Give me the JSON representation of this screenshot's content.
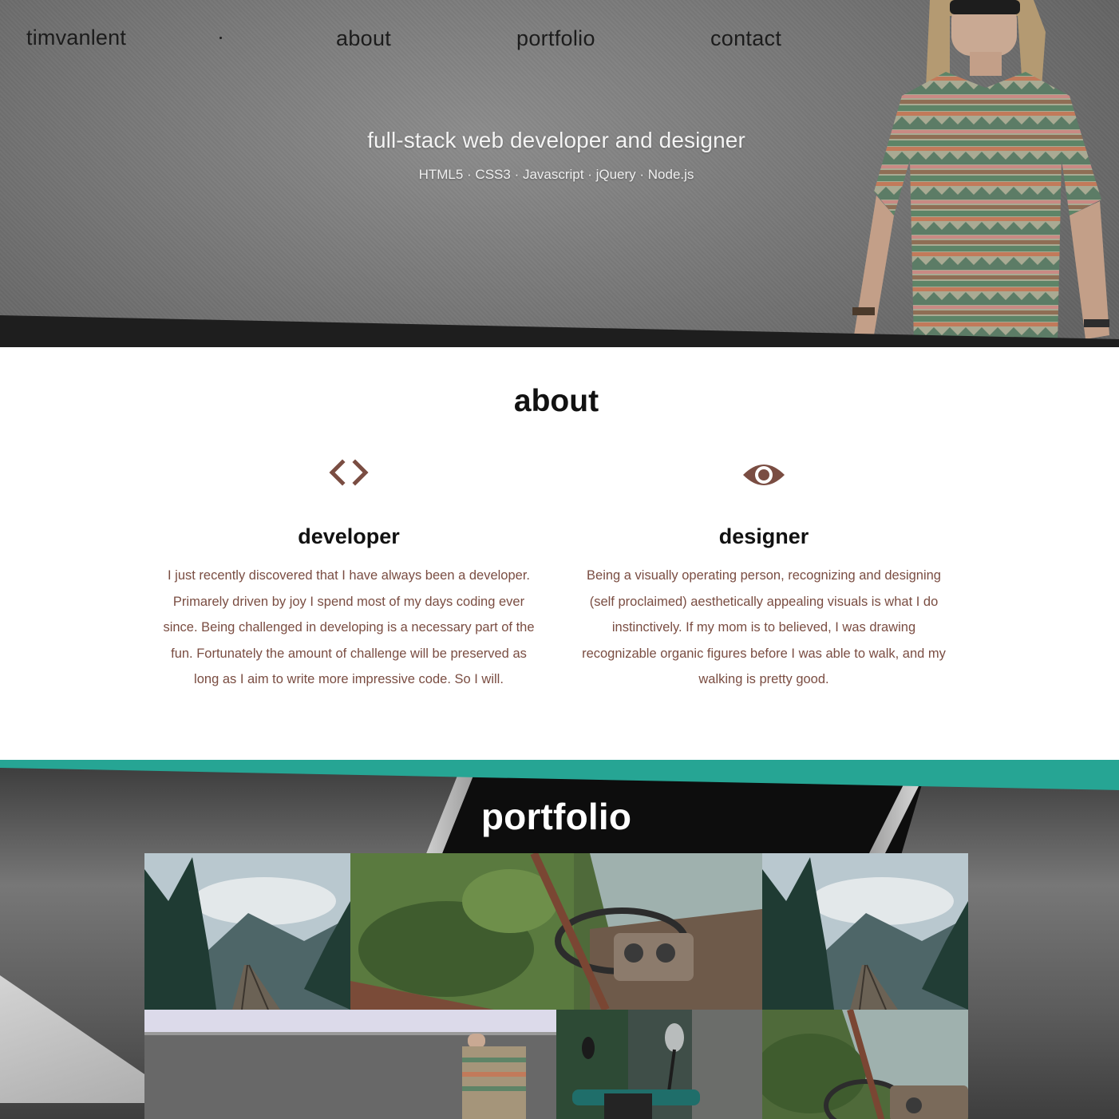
{
  "header": {
    "brand": "timvanlent",
    "nav": [
      {
        "label": "about"
      },
      {
        "label": "portfolio"
      },
      {
        "label": "contact"
      }
    ]
  },
  "hero": {
    "title": "full-stack web developer and designer",
    "skills": "HTML5 · CSS3 · Javascript · jQuery · Node.js"
  },
  "about": {
    "heading": "about",
    "columns": [
      {
        "icon": "code-brackets-icon",
        "title": "developer",
        "text": "I just recently discovered that I have always been a developer. Primarely driven by joy I spend most of my days coding ever since. Being challenged in developing is a necessary part of the fun. Fortunately the amount of challenge will be preserved as long as I aim to write more impressive code. So I will."
      },
      {
        "icon": "eye-icon",
        "title": "designer",
        "text": "Being a visually operating person, recognizing and designing (self proclaimed) aesthetically appealing visuals is what I do instinctively. If my mom is to believed, I was drawing recognizable organic figures before I was able to walk, and my walking is pretty good."
      }
    ]
  },
  "portfolio": {
    "heading": "portfolio",
    "tiles": [
      {
        "subject": "railway-bridge-forest-thumbnail"
      },
      {
        "subject": "abandoned-car-dashboard-thumbnail"
      },
      {
        "subject": "railway-bridge-forest-thumbnail"
      },
      {
        "subject": "website-hero-screenshot-thumbnail"
      },
      {
        "subject": "scooter-mirror-thumbnail"
      },
      {
        "subject": "abandoned-car-dashboard-thumbnail"
      }
    ]
  },
  "colors": {
    "accent_teal": "#26a594",
    "text_brown": "#7a4d42",
    "icon_brown": "#7a4d42",
    "hero_gray": "#7a7a7a"
  }
}
